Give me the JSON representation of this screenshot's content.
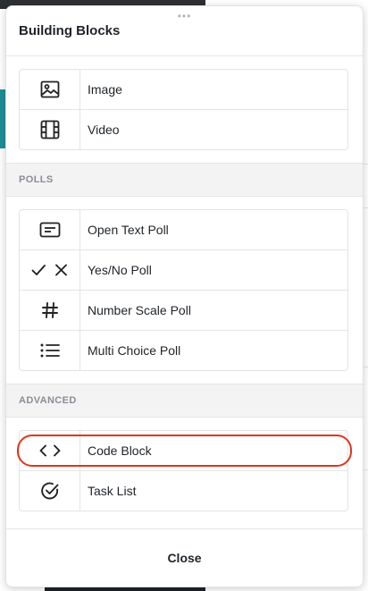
{
  "panel": {
    "title": "Building Blocks",
    "drag_handle_glyph": "•••"
  },
  "media_items": [
    {
      "label": "Image",
      "icon": "image-icon"
    },
    {
      "label": "Video",
      "icon": "film-icon"
    }
  ],
  "polls": {
    "section_label": "POLLS",
    "items": [
      {
        "label": "Open Text Poll",
        "icon": "text-box-icon"
      },
      {
        "label": "Yes/No Poll",
        "icon": "check-x-icon"
      },
      {
        "label": "Number Scale Poll",
        "icon": "hash-icon"
      },
      {
        "label": "Multi Choice Poll",
        "icon": "list-icon"
      }
    ]
  },
  "advanced": {
    "section_label": "ADVANCED",
    "items": [
      {
        "label": "Code Block",
        "icon": "code-icon",
        "highlighted": true
      },
      {
        "label": "Task List",
        "icon": "check-circle-icon"
      }
    ]
  },
  "footer": {
    "close_label": "Close"
  },
  "colors": {
    "highlight_outline": "#e0351b",
    "section_background": "#f3f3f4",
    "section_text": "#8a8d93"
  }
}
